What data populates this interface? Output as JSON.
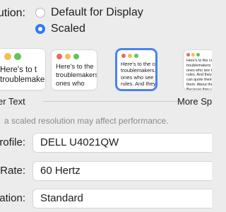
{
  "resolution": {
    "label": "ution:",
    "options": [
      {
        "label": "Default for Display",
        "selected": false
      },
      {
        "label": "Scaled",
        "selected": true
      }
    ]
  },
  "thumbnails": [
    {
      "text": "Here's to t\ntroublemake",
      "selected": false
    },
    {
      "text": "Here's to the\ntroublemakers.\nones who",
      "selected": false
    },
    {
      "text": "Here's to the cr\ntroublemakers.\nones who see t\nrules. And they",
      "selected": true
    },
    {
      "text": "Here's to the crazy\ntroublemakers. The\nones who see thing\nrules. And they hav\ncan quote them, dis\nthem. About the on\nBecause they chang",
      "selected": false
    }
  ],
  "scale_labels": {
    "left": "er Text",
    "right": "More Sp"
  },
  "warning_text": "a scaled resolution may affect performance.",
  "colors": {
    "accent": "#2f7bf6",
    "selected_outline": "#4a82f0",
    "close": "#ec6a5f",
    "minimize": "#f4bf4f",
    "zoom": "#61c554"
  },
  "fields": [
    {
      "label": "rofile:",
      "value": "DELL U4021QW"
    },
    {
      "label": "Rate:",
      "value": "60 Hertz"
    },
    {
      "label": "ation:",
      "value": "Standard"
    }
  ]
}
